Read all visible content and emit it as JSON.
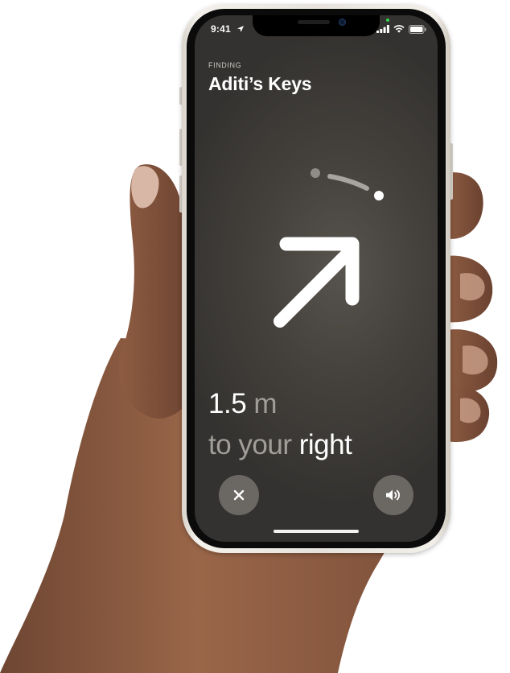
{
  "status_bar": {
    "time": "9:41",
    "icons": [
      "location-arrow-icon",
      "cellular-signal-icon",
      "wifi-icon",
      "battery-icon"
    ],
    "privacy_indicator_color": "#35d14b"
  },
  "finding": {
    "label": "FINDING",
    "item_name": "Aditi’s Keys"
  },
  "direction_indicator": {
    "icon": "arrow-up-right-icon",
    "compass_arc_icon": "direction-arc-icon"
  },
  "distance": {
    "value": "1.5",
    "unit": "m"
  },
  "direction_text": {
    "prefix": "to your",
    "side": "right"
  },
  "buttons": {
    "close_icon": "close-icon",
    "sound_icon": "speaker-icon"
  },
  "colors": {
    "screen_background": "#45423d",
    "text_primary": "#ffffff",
    "text_secondary": "#a19e99",
    "button_background": "#6b6864",
    "phone_frame": "#ece8e2"
  }
}
